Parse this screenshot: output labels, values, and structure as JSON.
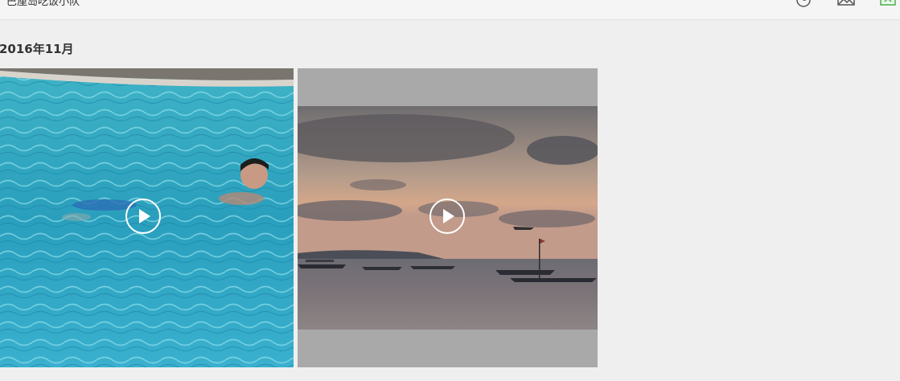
{
  "header": {
    "chat_title": "巴厘岛吃饭小队",
    "icons": [
      "history-icon",
      "gallery-icon",
      "video-icon"
    ]
  },
  "section": {
    "month_label": "2016年11月"
  },
  "videos": [
    {
      "thumbnail": "swimming-pool",
      "overlay_icon": "play-icon"
    },
    {
      "thumbnail": "sunset-sea-boats",
      "overlay_icon": "play-icon"
    }
  ],
  "colors": {
    "background": "#efefef",
    "video_icon_accent": "#4caf50"
  }
}
